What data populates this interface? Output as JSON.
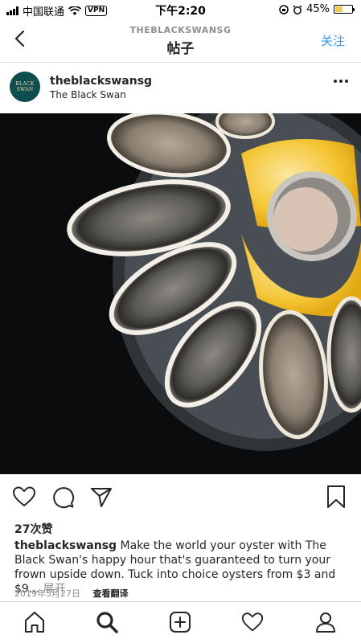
{
  "status_bar": {
    "carrier": "中国联通",
    "vpn": "VPN",
    "time": "下午2:20",
    "battery": "45%"
  },
  "nav": {
    "subtitle": "THEBLACKSWANSG",
    "title": "帖子",
    "follow_label": "关注"
  },
  "post": {
    "avatar_lines": [
      "BLACK",
      "SWAN"
    ],
    "username": "theblackswansg",
    "location": "The Black Swan",
    "likes": "27次赞",
    "caption_user": "theblackswansg",
    "caption_text": "Make the world your oyster with The Black Swan's happy hour that's guaranteed to turn your frown upside down. Tuck into choice oysters from $3 and $9...",
    "caption_more": "展开",
    "date": "2019年5月27日",
    "translate": "查看翻译"
  },
  "icons": {
    "actions": [
      "heart-icon",
      "comment-icon",
      "share-icon",
      "bookmark-icon"
    ],
    "tabs": [
      "home-icon",
      "search-icon",
      "add-post-icon",
      "activity-heart-icon",
      "profile-icon"
    ]
  },
  "colors": {
    "accent": "#3897f0",
    "avatar_bg": "#0f4d4f",
    "text": "#262626",
    "muted": "#8e8e8e",
    "lemon": "#f4c431"
  }
}
